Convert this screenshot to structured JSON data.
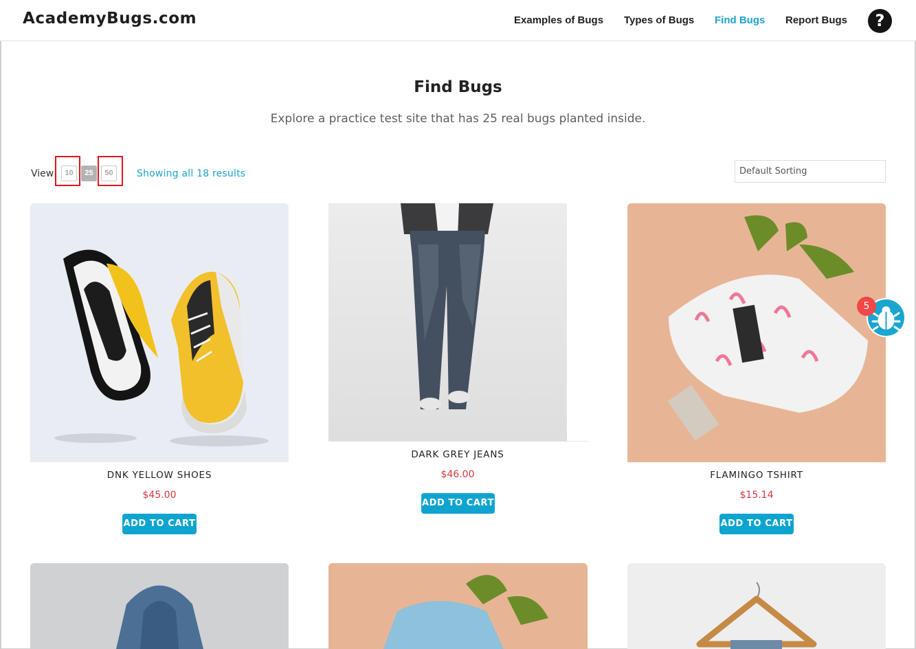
{
  "header": {
    "logo": "AcademyBugs.com",
    "nav": [
      "Examples of Bugs",
      "Types of Bugs",
      "Find Bugs",
      "Report Bugs"
    ],
    "active_nav": "Find Bugs",
    "help_glyph": "?"
  },
  "hero": {
    "title": "Find Bugs",
    "subtitle": "Explore a practice test site that has 25 real bugs planted inside."
  },
  "toolbar": {
    "view_label": "View",
    "view_options": [
      "10",
      "25",
      "50"
    ],
    "selected_view": "25",
    "results_text": "Showing all 18 results",
    "sort_value": "Default Sorting"
  },
  "products": [
    {
      "name": "DNK YELLOW SHOES",
      "price": "$45.00",
      "cart_label": "ADD TO CART"
    },
    {
      "name": "DARK GREY JEANS",
      "price": "$46.00",
      "cart_label": "ADD TO CART"
    },
    {
      "name": "FLAMINGO TSHIRT",
      "price": "$15.14",
      "cart_label": "ADD TO CART"
    }
  ],
  "bug_widget": {
    "count": "5",
    "icon": "bug-icon"
  },
  "colors": {
    "accent": "#1aa3cf",
    "price": "#d9363e",
    "highlight": "#e0141c",
    "badge": "#f04747"
  }
}
